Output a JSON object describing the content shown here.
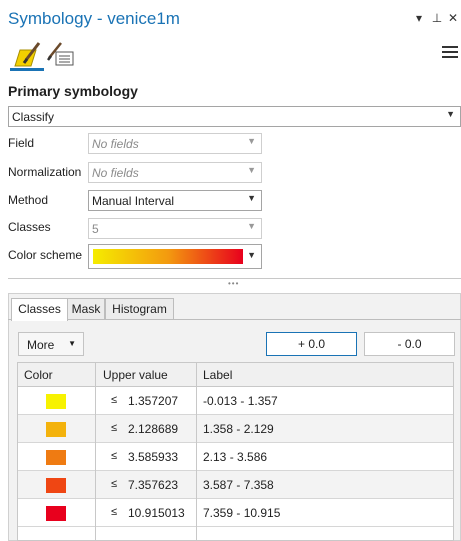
{
  "window": {
    "title": "Symbology - venice1m",
    "controls": {
      "options": "▾",
      "pin": "⊥",
      "close": "✕"
    }
  },
  "toolbar": {
    "tabs": [
      {
        "icon": "primary-symbology-brush-icon",
        "active": true
      },
      {
        "icon": "vary-symbology-brush-icon",
        "active": false
      }
    ],
    "menu_icon": "hamburger-menu-icon"
  },
  "primary": {
    "title": "Primary symbology",
    "renderer": "Classify",
    "field": {
      "label": "Field",
      "value": "No fields"
    },
    "normalization": {
      "label": "Normalization",
      "value": "No fields"
    },
    "method": {
      "label": "Method",
      "value": "Manual Interval"
    },
    "classes": {
      "label": "Classes",
      "value": "5"
    },
    "color_scheme": {
      "label": "Color scheme",
      "from": "#f5ec00",
      "via": "#f39a0f",
      "to": "#e8001d"
    }
  },
  "tabs": [
    "Classes",
    "Mask",
    "Histogram"
  ],
  "more_label": "More",
  "shift_plus": "+ 0.0",
  "shift_minus": "- 0.0",
  "table": {
    "headers": [
      "Color",
      "Upper value",
      "Label"
    ],
    "rows": [
      {
        "color": "#f7f201",
        "leq": "≤",
        "upper": "1.357207",
        "label": "-0.013 - 1.357"
      },
      {
        "color": "#f3b20c",
        "leq": "≤",
        "upper": "2.128689",
        "label": "1.358 - 2.129"
      },
      {
        "color": "#ef7b12",
        "leq": "≤",
        "upper": "3.585933",
        "label": "2.13 - 3.586"
      },
      {
        "color": "#ef4613",
        "leq": "≤",
        "upper": "7.357623",
        "label": "3.587 - 7.358"
      },
      {
        "color": "#e8001d",
        "leq": "≤",
        "upper": "10.915013",
        "label": "7.359 - 10.915"
      }
    ]
  }
}
